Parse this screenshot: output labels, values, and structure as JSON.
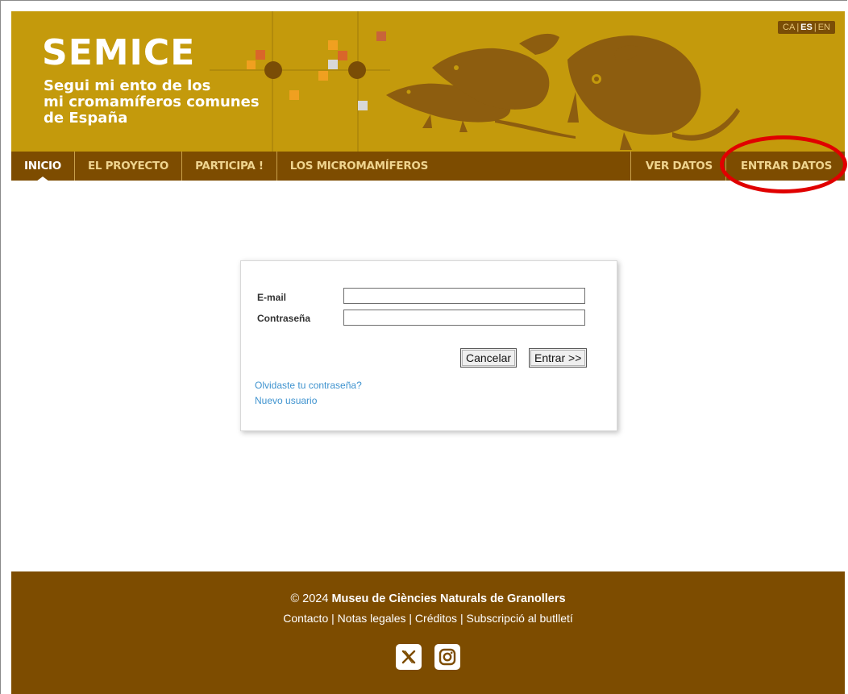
{
  "header": {
    "title": "SEMICE",
    "subtitle_lines": [
      "Segui mi ento de los",
      "mi cromamíferos comunes",
      "de España"
    ],
    "languages": [
      "CA",
      "ES",
      "EN"
    ],
    "language_active": "ES",
    "lang_sep": "|"
  },
  "nav": {
    "items": [
      "INICIO",
      "EL PROYECTO",
      "PARTICIPA !",
      "LOS MICROMAMÍFEROS"
    ],
    "right_items": [
      "VER DATOS",
      "ENTRAR DATOS"
    ],
    "active": "INICIO"
  },
  "login": {
    "email_label": "E-mail",
    "email_value": "",
    "password_label": "Contraseña",
    "password_value": "",
    "cancel_label": "Cancelar",
    "submit_label": "Entrar >>",
    "forgot_link": "Olvidaste tu contraseña?",
    "new_user_link": "Nuevo usuario"
  },
  "footer": {
    "copyright_prefix": "© 2024",
    "org_name": "Museu de Ciències Naturals de Granollers",
    "links": [
      "Contacto",
      "Notas legales",
      "Créditos",
      "Subscripció al butlletí"
    ],
    "link_sep": "|",
    "socials": [
      "x-icon",
      "instagram-icon"
    ]
  },
  "colors": {
    "banner": "#c49a0c",
    "nav": "#7d4c00",
    "footer": "#7d4c00",
    "link": "#3f93cf",
    "highlight": "#e00000"
  }
}
